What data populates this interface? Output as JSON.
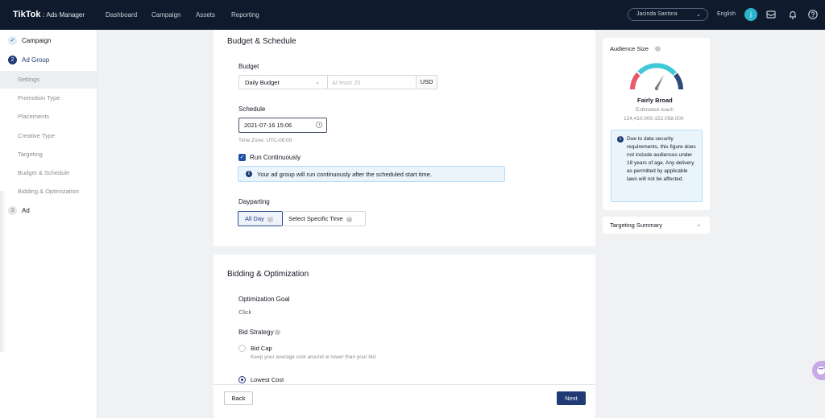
{
  "topnav": {
    "brand": "TikTok",
    "brand_suffix": ": Ads Manager",
    "links": [
      "Dashboard",
      "Campaign",
      "Assets",
      "Reporting"
    ],
    "account": "Jacinda Santora",
    "language": "English",
    "avatar_initial": "j"
  },
  "sidebar": {
    "step1": "Campaign",
    "step2_num": "2",
    "step2": "Ad Group",
    "subitems": [
      "Settings",
      "Promotion Type",
      "Placements",
      "Creative Type",
      "Targeting",
      "Budget & Schedule",
      "Bidding & Optimization"
    ],
    "step3_num": "3",
    "step3": "Ad"
  },
  "budget_schedule": {
    "title": "Budget & Schedule",
    "budget_label": "Budget",
    "budget_type": "Daily Budget",
    "budget_placeholder": "At least 20",
    "currency": "USD",
    "schedule_label": "Schedule",
    "schedule_value": "2021-07-16 15:06",
    "timezone": "Time Zone: UTC-06:00",
    "run_continuously": "Run Continuously",
    "info_text": "Your ad group will run continuously after the scheduled start time.",
    "dayparting_label": "Dayparting",
    "all_day": "All Day",
    "specific_time": "Select Specific Time"
  },
  "bidding": {
    "title": "Bidding & Optimization",
    "goal_label": "Optimization Goal",
    "goal_value": "Click",
    "strategy_label": "Bid Strategy",
    "bid_cap": "Bid Cap",
    "bid_cap_desc": "Keep your average cost around or lower than your bid.",
    "lowest_cost": "Lowest Cost"
  },
  "footer": {
    "back": "Back",
    "next": "Next"
  },
  "audience": {
    "title": "Audience Size",
    "status": "Fairly Broad",
    "reach_label": "Estimated reach",
    "reach_value": "124,410,000-152,058,000",
    "note": "Due to data security requirements, this figure does not include audiences under 18 years of age. Any delivery as permitted by applicable laws will not be affected.",
    "targeting_summary": "Targeting Summary"
  },
  "colors": {
    "nav_bg": "#0f1b2d",
    "primary": "#1f3a75",
    "gauge_red": "#e8596b",
    "gauge_teal": "#3ec8d8",
    "gauge_navy": "#2d4a7a"
  }
}
